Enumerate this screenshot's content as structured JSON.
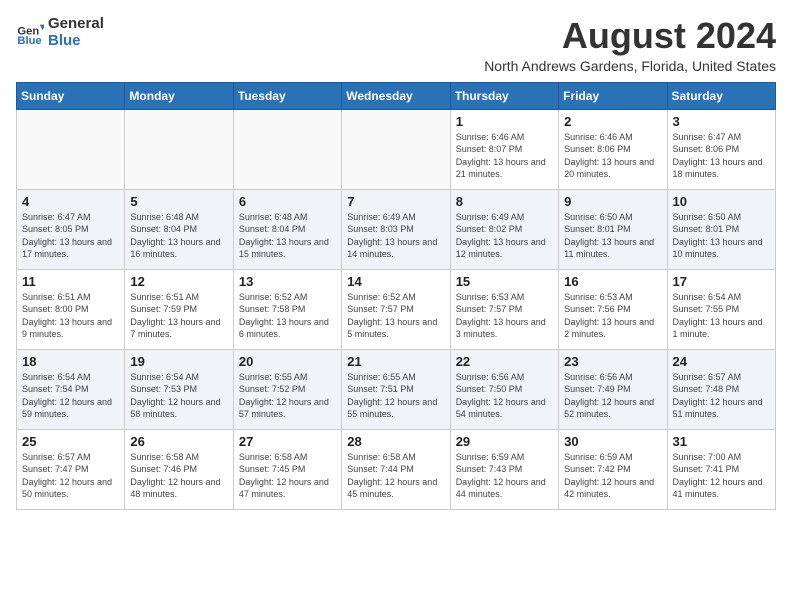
{
  "logo": {
    "general": "General",
    "blue": "Blue"
  },
  "title": "August 2024",
  "location": "North Andrews Gardens, Florida, United States",
  "days_of_week": [
    "Sunday",
    "Monday",
    "Tuesday",
    "Wednesday",
    "Thursday",
    "Friday",
    "Saturday"
  ],
  "weeks": [
    [
      {
        "day": "",
        "info": ""
      },
      {
        "day": "",
        "info": ""
      },
      {
        "day": "",
        "info": ""
      },
      {
        "day": "",
        "info": ""
      },
      {
        "day": "1",
        "info": "Sunrise: 6:46 AM\nSunset: 8:07 PM\nDaylight: 13 hours and 21 minutes."
      },
      {
        "day": "2",
        "info": "Sunrise: 6:46 AM\nSunset: 8:06 PM\nDaylight: 13 hours and 20 minutes."
      },
      {
        "day": "3",
        "info": "Sunrise: 6:47 AM\nSunset: 8:06 PM\nDaylight: 13 hours and 18 minutes."
      }
    ],
    [
      {
        "day": "4",
        "info": "Sunrise: 6:47 AM\nSunset: 8:05 PM\nDaylight: 13 hours and 17 minutes."
      },
      {
        "day": "5",
        "info": "Sunrise: 6:48 AM\nSunset: 8:04 PM\nDaylight: 13 hours and 16 minutes."
      },
      {
        "day": "6",
        "info": "Sunrise: 6:48 AM\nSunset: 8:04 PM\nDaylight: 13 hours and 15 minutes."
      },
      {
        "day": "7",
        "info": "Sunrise: 6:49 AM\nSunset: 8:03 PM\nDaylight: 13 hours and 14 minutes."
      },
      {
        "day": "8",
        "info": "Sunrise: 6:49 AM\nSunset: 8:02 PM\nDaylight: 13 hours and 12 minutes."
      },
      {
        "day": "9",
        "info": "Sunrise: 6:50 AM\nSunset: 8:01 PM\nDaylight: 13 hours and 11 minutes."
      },
      {
        "day": "10",
        "info": "Sunrise: 6:50 AM\nSunset: 8:01 PM\nDaylight: 13 hours and 10 minutes."
      }
    ],
    [
      {
        "day": "11",
        "info": "Sunrise: 6:51 AM\nSunset: 8:00 PM\nDaylight: 13 hours and 9 minutes."
      },
      {
        "day": "12",
        "info": "Sunrise: 6:51 AM\nSunset: 7:59 PM\nDaylight: 13 hours and 7 minutes."
      },
      {
        "day": "13",
        "info": "Sunrise: 6:52 AM\nSunset: 7:58 PM\nDaylight: 13 hours and 6 minutes."
      },
      {
        "day": "14",
        "info": "Sunrise: 6:52 AM\nSunset: 7:57 PM\nDaylight: 13 hours and 5 minutes."
      },
      {
        "day": "15",
        "info": "Sunrise: 6:53 AM\nSunset: 7:57 PM\nDaylight: 13 hours and 3 minutes."
      },
      {
        "day": "16",
        "info": "Sunrise: 6:53 AM\nSunset: 7:56 PM\nDaylight: 13 hours and 2 minutes."
      },
      {
        "day": "17",
        "info": "Sunrise: 6:54 AM\nSunset: 7:55 PM\nDaylight: 13 hours and 1 minute."
      }
    ],
    [
      {
        "day": "18",
        "info": "Sunrise: 6:54 AM\nSunset: 7:54 PM\nDaylight: 12 hours and 59 minutes."
      },
      {
        "day": "19",
        "info": "Sunrise: 6:54 AM\nSunset: 7:53 PM\nDaylight: 12 hours and 58 minutes."
      },
      {
        "day": "20",
        "info": "Sunrise: 6:55 AM\nSunset: 7:52 PM\nDaylight: 12 hours and 57 minutes."
      },
      {
        "day": "21",
        "info": "Sunrise: 6:55 AM\nSunset: 7:51 PM\nDaylight: 12 hours and 55 minutes."
      },
      {
        "day": "22",
        "info": "Sunrise: 6:56 AM\nSunset: 7:50 PM\nDaylight: 12 hours and 54 minutes."
      },
      {
        "day": "23",
        "info": "Sunrise: 6:56 AM\nSunset: 7:49 PM\nDaylight: 12 hours and 52 minutes."
      },
      {
        "day": "24",
        "info": "Sunrise: 6:57 AM\nSunset: 7:48 PM\nDaylight: 12 hours and 51 minutes."
      }
    ],
    [
      {
        "day": "25",
        "info": "Sunrise: 6:57 AM\nSunset: 7:47 PM\nDaylight: 12 hours and 50 minutes."
      },
      {
        "day": "26",
        "info": "Sunrise: 6:58 AM\nSunset: 7:46 PM\nDaylight: 12 hours and 48 minutes."
      },
      {
        "day": "27",
        "info": "Sunrise: 6:58 AM\nSunset: 7:45 PM\nDaylight: 12 hours and 47 minutes."
      },
      {
        "day": "28",
        "info": "Sunrise: 6:58 AM\nSunset: 7:44 PM\nDaylight: 12 hours and 45 minutes."
      },
      {
        "day": "29",
        "info": "Sunrise: 6:59 AM\nSunset: 7:43 PM\nDaylight: 12 hours and 44 minutes."
      },
      {
        "day": "30",
        "info": "Sunrise: 6:59 AM\nSunset: 7:42 PM\nDaylight: 12 hours and 42 minutes."
      },
      {
        "day": "31",
        "info": "Sunrise: 7:00 AM\nSunset: 7:41 PM\nDaylight: 12 hours and 41 minutes."
      }
    ]
  ]
}
